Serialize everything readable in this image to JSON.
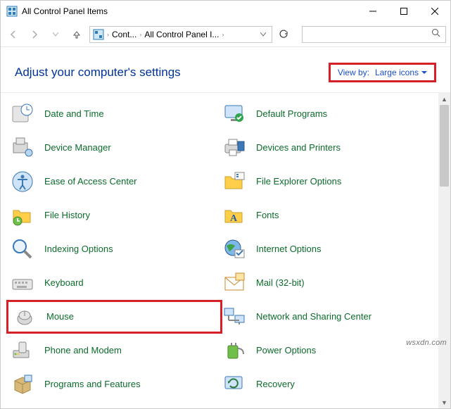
{
  "window": {
    "title": "All Control Panel Items"
  },
  "breadcrumb": {
    "seg1": "Cont...",
    "seg2": "All Control Panel I..."
  },
  "header": {
    "heading": "Adjust your computer's settings",
    "viewby_label": "View by:",
    "viewby_value": "Large icons"
  },
  "items": {
    "date_time": "Date and Time",
    "default_programs": "Default Programs",
    "device_manager": "Device Manager",
    "devices_printers": "Devices and Printers",
    "ease_access": "Ease of Access Center",
    "file_explorer_opts": "File Explorer Options",
    "file_history": "File History",
    "fonts": "Fonts",
    "indexing": "Indexing Options",
    "internet": "Internet Options",
    "keyboard": "Keyboard",
    "mail": "Mail (32-bit)",
    "mouse": "Mouse",
    "network_sharing": "Network and Sharing Center",
    "phone_modem": "Phone and Modem",
    "power": "Power Options",
    "programs_features": "Programs and Features",
    "recovery": "Recovery"
  },
  "watermark": "wsxdn.com"
}
